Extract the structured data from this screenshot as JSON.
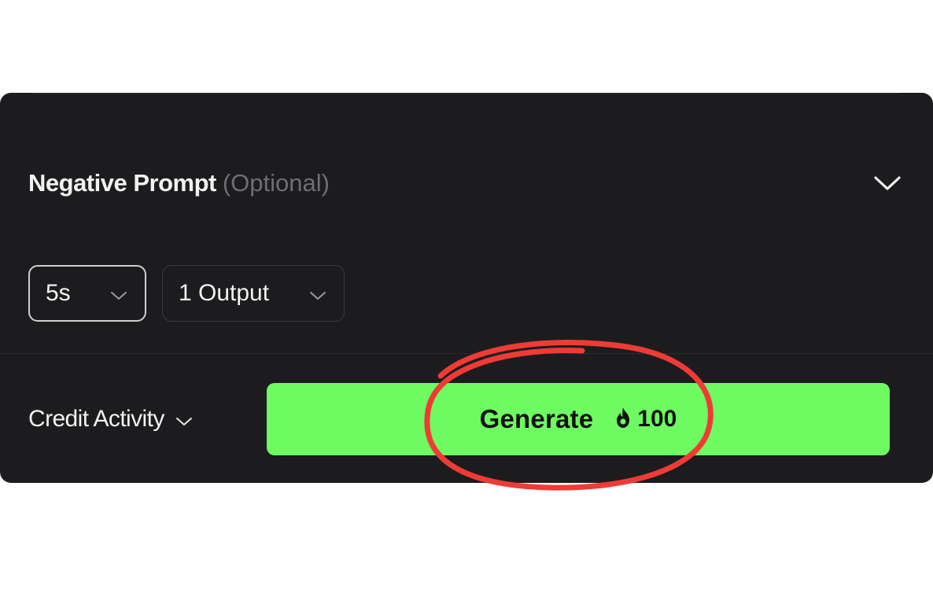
{
  "negative_prompt": {
    "title": "Negative Prompt",
    "optional": "(Optional)",
    "toggle_icon": "chevron-down-icon"
  },
  "dropdowns": {
    "duration": {
      "value": "5s",
      "icon": "chevron-down-icon"
    },
    "outputs": {
      "value": "1 Output",
      "icon": "chevron-down-icon"
    }
  },
  "credit_activity": {
    "label": "Credit Activity",
    "icon": "chevron-down-icon"
  },
  "generate_button": {
    "label": "Generate",
    "cost_icon": "flame-icon",
    "cost": "100",
    "color": "#6dfb61"
  },
  "colors": {
    "panel_background": "#1c1c1e",
    "annotation_circle": "#ef3b36"
  }
}
